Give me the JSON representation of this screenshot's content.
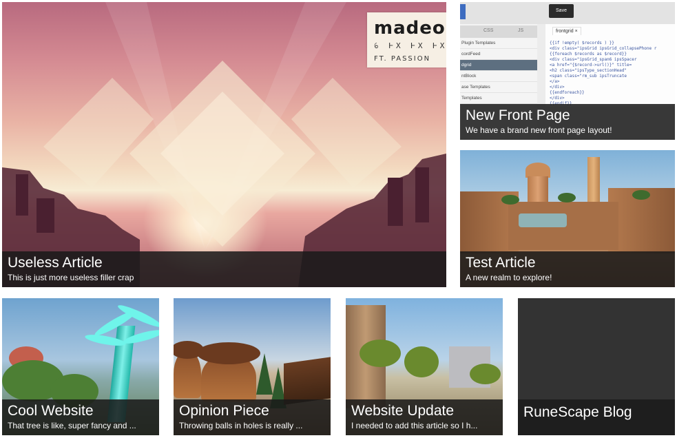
{
  "tiles": {
    "useless": {
      "title": "Useless Article",
      "subtitle": "This is just more useless filler crap",
      "art_text": {
        "big": "madeo",
        "runes": "ꕃ ⱵX  ⱵX  ⱵX",
        "ft": "FT. PASSION"
      }
    },
    "frontpage": {
      "title": "New Front Page",
      "subtitle": "We have a brand new front page layout!",
      "art_text": {
        "save": "Save",
        "tab_css": "CSS",
        "tab_js": "JS",
        "code_tab": "frontgrid",
        "list": [
          "Plugin Templates",
          "cordFeed",
          "dgrid",
          "ntBlock",
          "ase Templates",
          "Templates"
        ],
        "code": [
          "{{if !empty( $records ) }}",
          "  <div class=\"ipsGrid ipsGrid_collapsePhone r",
          "    {{foreach $records as $record}}",
          "      <div class=\"ipsGrid_span6 ipsSpacer",
          "        <a href=\"{$record->url()}\" title=",
          "        <h2 class=\"ipsType_sectionHead\"",
          "        <span class=\"rm_sub ipsTruncate",
          "        </a>",
          "      </div>",
          "    {{endforeach}}",
          "  </div>",
          "{{endif}}"
        ]
      }
    },
    "test": {
      "title": "Test Article",
      "subtitle": "A new realm to explore!"
    },
    "cool": {
      "title": "Cool Website",
      "subtitle": "That tree is like, super fancy and ..."
    },
    "opinion": {
      "title": "Opinion Piece",
      "subtitle": "Throwing balls in holes is really ..."
    },
    "update": {
      "title": "Website Update",
      "subtitle": "I needed to add this article so I h..."
    },
    "blog": {
      "title": "RuneScape Blog",
      "subtitle": ""
    }
  },
  "colors": {
    "caption_bg": "#1a1a1a",
    "blog_bg": "#333333"
  },
  "icons": {
    "close": "close-icon"
  }
}
